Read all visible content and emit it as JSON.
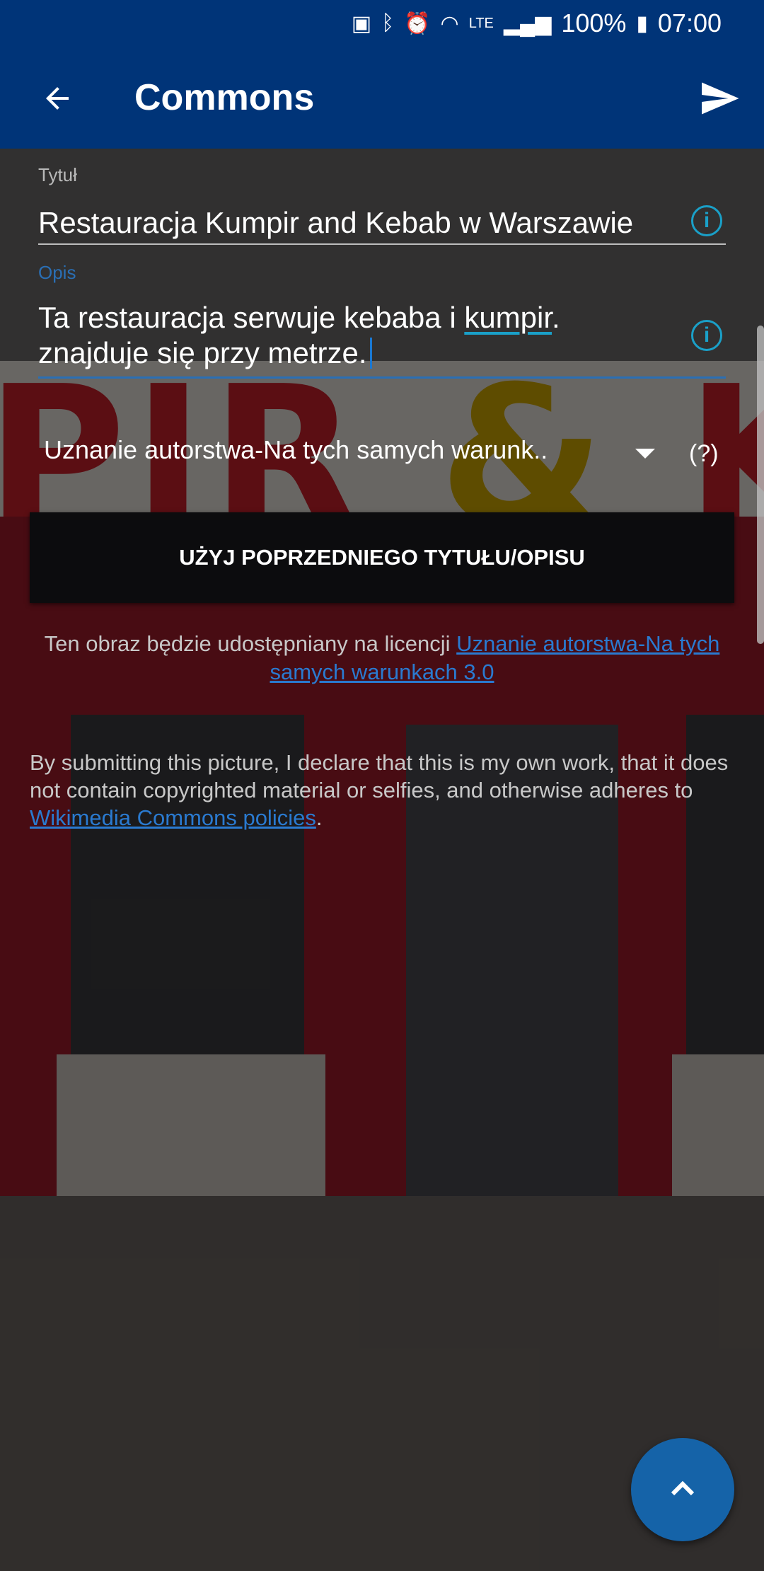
{
  "status_bar": {
    "battery": "100%",
    "time": "07:00",
    "network": "LTE",
    "icons": [
      "battery-saver-icon",
      "bluetooth-icon",
      "alarm-icon",
      "wifi-icon",
      "signal-icon",
      "battery-icon"
    ]
  },
  "app_bar": {
    "title": "Commons",
    "back_icon": "arrow-back-icon",
    "send_icon": "send-icon"
  },
  "form": {
    "title_label": "Tytuł",
    "title_value": "Restauracja Kumpir and Kebab w Warszawie",
    "description_label": "Opis",
    "description_line1_before": "Ta restauracja serwuje kebaba i ",
    "description_line1_spell": "kumpir",
    "description_line1_after": ".",
    "description_line2": "znajduje się przy metrze.",
    "license_selected": "Uznanie autorstwa-Na tych samych warunk..",
    "license_help": "(?)",
    "prev_button": "UŻYJ POPRZEDNIEGO TYTUŁU/OPISU"
  },
  "license_note": {
    "prefix": "Ten obraz będzie udostępniany na licencji ",
    "link": "Uznanie autorstwa-Na tych samych warunkach 3.0"
  },
  "declaration": {
    "text": "By submitting this picture, I declare that this is my own work, that it does not contain copyrighted material or selfies, and otherwise adheres to ",
    "link": "Wikimedia Commons policies",
    "suffix": "."
  },
  "fab": {
    "icon": "chevron-up-icon"
  },
  "colors": {
    "app_bar": "#003478",
    "accent": "#2a6fb5",
    "info_icon": "#1aa0c8",
    "fab": "#1563a8"
  }
}
